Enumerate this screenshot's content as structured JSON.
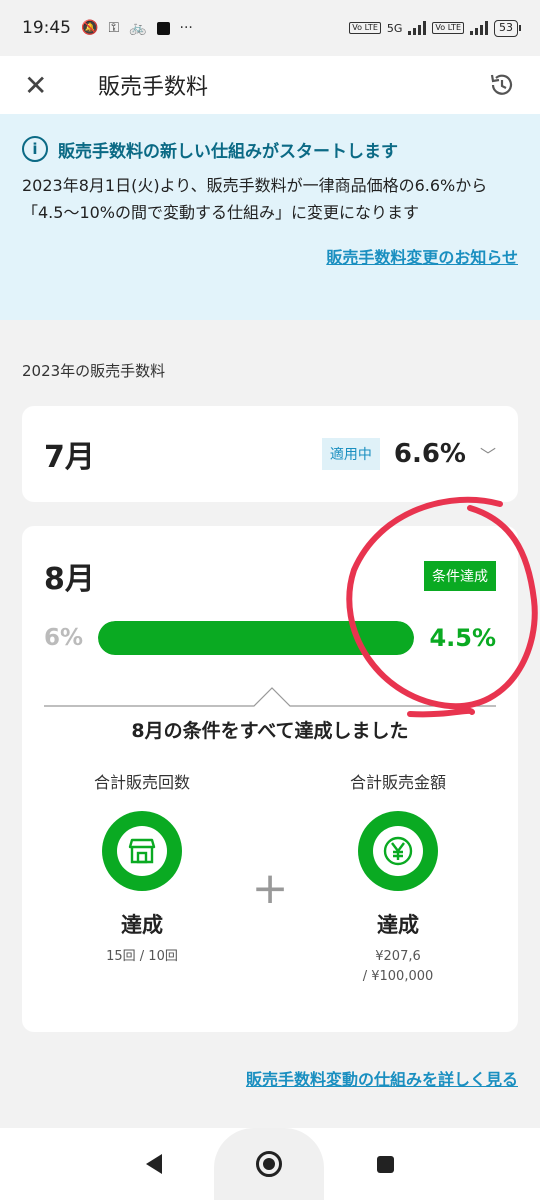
{
  "status_bar": {
    "time": "19:45",
    "network": "5G",
    "lte_label": "Vo LTE",
    "battery": "53"
  },
  "app_bar": {
    "title": "販売手数料",
    "close_glyph": "✕"
  },
  "notice": {
    "heading": "販売手数料の新しい仕組みがスタートします",
    "body": "2023年8月1日(火)より、販売手数料が一律商品価格の6.6%から「4.5〜10%の間で変動する仕組み」に変更になります",
    "link": "販売手数料変更のお知らせ"
  },
  "section_label": "2023年の販売手数料",
  "july": {
    "month": "7月",
    "badge": "適用中",
    "rate": "6.6%"
  },
  "august": {
    "month": "8月",
    "badge": "条件達成",
    "old_rate": "6%",
    "new_rate": "4.5%",
    "progress": 1.0,
    "done_title": "8月の条件をすべて達成しました",
    "conditions": [
      {
        "label": "合計販売回数",
        "icon": "store-icon",
        "status": "達成",
        "detail": "15回 / 10回"
      },
      {
        "label": "合計販売金額",
        "icon": "yen-icon",
        "status": "達成",
        "detail": "¥207,6",
        "detail2": "/ ¥100,000"
      }
    ],
    "plus": "+"
  },
  "bottom_link": "販売手数料変動の仕組みを詳しく見る",
  "colors": {
    "green": "#0aaa22",
    "link": "#1a8fc0",
    "notice_bg": "#e2f3fa",
    "annotation_red": "#e8344f"
  }
}
